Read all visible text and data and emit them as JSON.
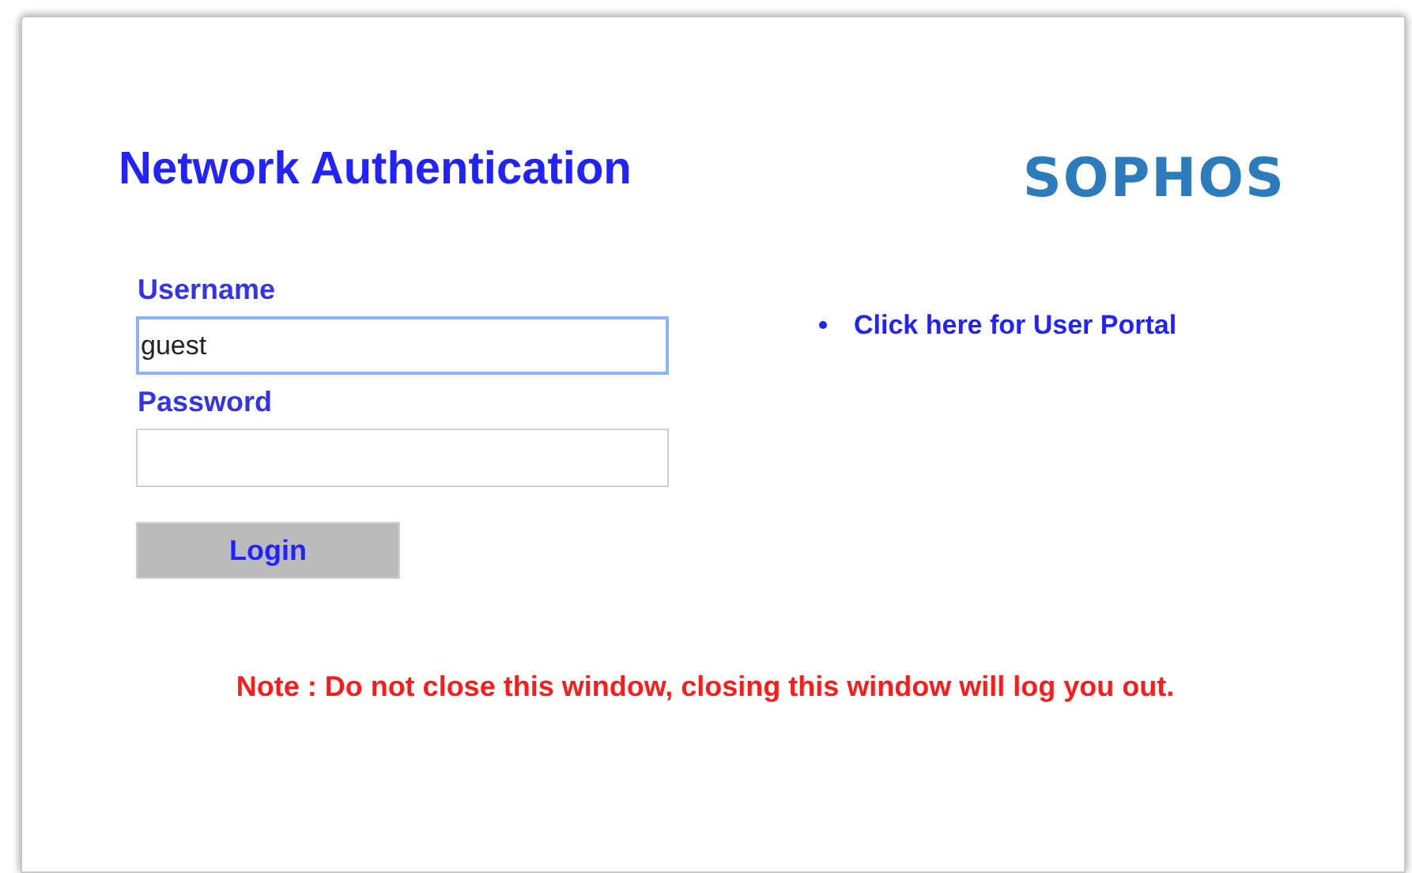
{
  "title": "Network Authentication",
  "logo": "SOPHOS",
  "fields": [
    {
      "label": "Username",
      "value": "guest",
      "focused": true
    },
    {
      "label": "Password",
      "focused": false
    }
  ],
  "login_button": "Login",
  "links": [
    "Click here for User Portal"
  ],
  "note": "Note : Do not close this window, closing this window will log you out."
}
